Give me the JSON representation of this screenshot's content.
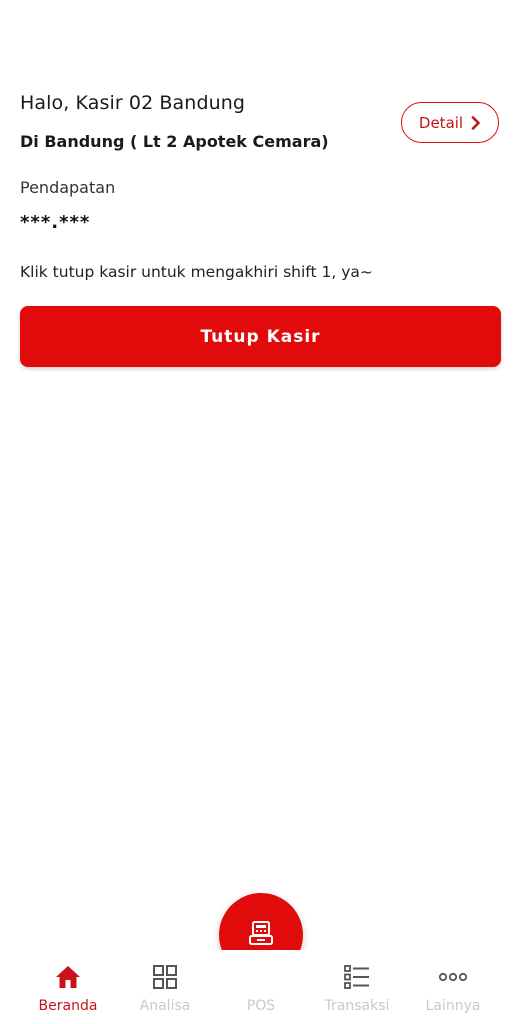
{
  "header": {
    "greeting": "Halo, Kasir 02 Bandung",
    "location": "Di Bandung ( Lt 2 Apotek Cemara)",
    "detail_label": "Detail"
  },
  "revenue": {
    "label": "Pendapatan",
    "value": "***.***"
  },
  "shift": {
    "hint": "Klik tutup kasir untuk mengakhiri shift 1, ya~",
    "close_label": "Tutup Kasir"
  },
  "nav": {
    "items": [
      {
        "label": "Beranda",
        "icon": "home-icon",
        "active": true
      },
      {
        "label": "Analisa",
        "icon": "grid-icon",
        "active": false
      },
      {
        "label": "POS",
        "icon": "cash-register-icon",
        "active": false
      },
      {
        "label": "Transaksi",
        "icon": "list-icon",
        "active": false
      },
      {
        "label": "Lainnya",
        "icon": "more-icon",
        "active": false
      }
    ]
  },
  "colors": {
    "primary": "#e20b0b",
    "active_nav": "#c8131b",
    "inactive_nav": "#c9c9c9"
  }
}
